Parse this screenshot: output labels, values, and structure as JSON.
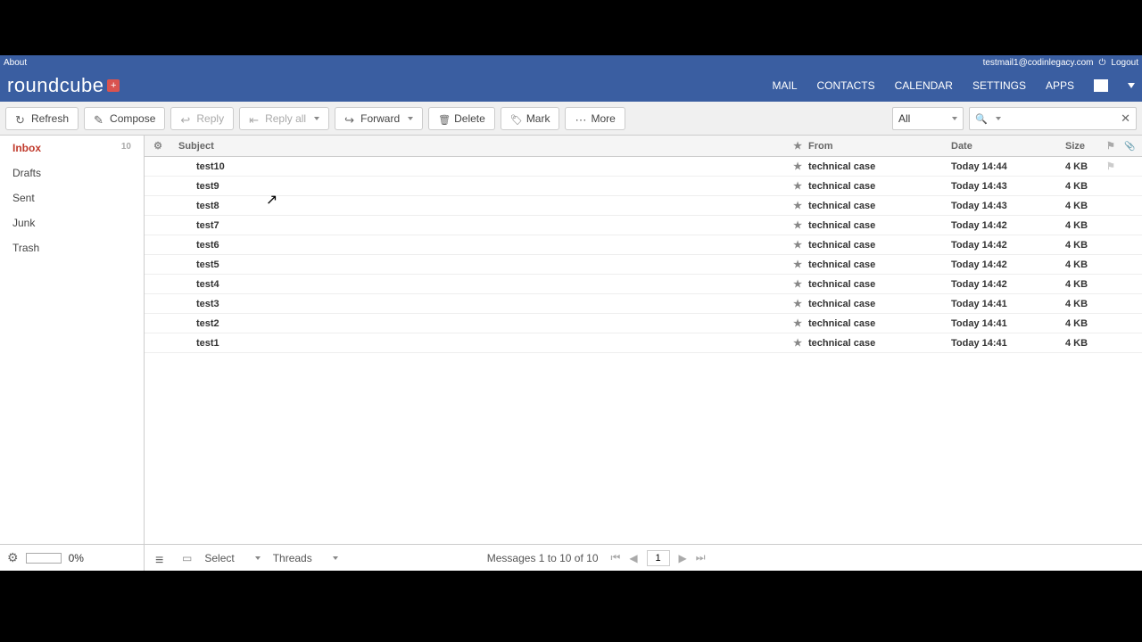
{
  "topbar": {
    "about": "About",
    "user": "testmail1@codinlegacy.com",
    "logout": "Logout"
  },
  "logo": {
    "text": "roundcube",
    "plus": "+"
  },
  "nav": {
    "mail": "MAIL",
    "contacts": "CONTACTS",
    "calendar": "CALENDAR",
    "settings": "SETTINGS",
    "apps": "APPS"
  },
  "toolbar": {
    "refresh": "Refresh",
    "compose": "Compose",
    "reply": "Reply",
    "replyall": "Reply all",
    "forward": "Forward",
    "delete": "Delete",
    "mark": "Mark",
    "more": "More",
    "filter": "All"
  },
  "folders": [
    {
      "name": "Inbox",
      "count": "10",
      "active": true
    },
    {
      "name": "Drafts",
      "count": "",
      "active": false
    },
    {
      "name": "Sent",
      "count": "",
      "active": false
    },
    {
      "name": "Junk",
      "count": "",
      "active": false
    },
    {
      "name": "Trash",
      "count": "",
      "active": false
    }
  ],
  "quota": "0%",
  "columns": {
    "subject": "Subject",
    "from": "From",
    "date": "Date",
    "size": "Size"
  },
  "messages": [
    {
      "subject": "test10",
      "from": "technical case",
      "date": "Today 14:44",
      "size": "4 KB"
    },
    {
      "subject": "test9",
      "from": "technical case",
      "date": "Today 14:43",
      "size": "4 KB"
    },
    {
      "subject": "test8",
      "from": "technical case",
      "date": "Today 14:43",
      "size": "4 KB"
    },
    {
      "subject": "test7",
      "from": "technical case",
      "date": "Today 14:42",
      "size": "4 KB"
    },
    {
      "subject": "test6",
      "from": "technical case",
      "date": "Today 14:42",
      "size": "4 KB"
    },
    {
      "subject": "test5",
      "from": "technical case",
      "date": "Today 14:42",
      "size": "4 KB"
    },
    {
      "subject": "test4",
      "from": "technical case",
      "date": "Today 14:42",
      "size": "4 KB"
    },
    {
      "subject": "test3",
      "from": "technical case",
      "date": "Today 14:41",
      "size": "4 KB"
    },
    {
      "subject": "test2",
      "from": "technical case",
      "date": "Today 14:41",
      "size": "4 KB"
    },
    {
      "subject": "test1",
      "from": "technical case",
      "date": "Today 14:41",
      "size": "4 KB"
    }
  ],
  "footer": {
    "select": "Select",
    "threads": "Threads",
    "status": "Messages 1 to 10 of 10",
    "page": "1"
  }
}
